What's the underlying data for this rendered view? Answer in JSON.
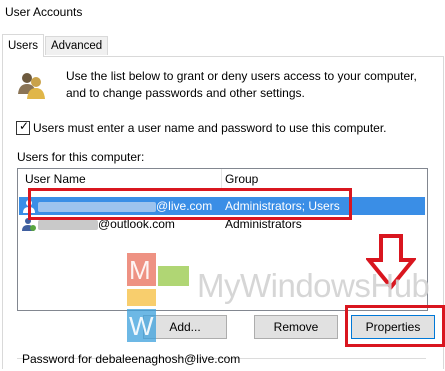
{
  "window": {
    "title": "User Accounts"
  },
  "tabs": [
    {
      "label": "Users",
      "active": true
    },
    {
      "label": "Advanced",
      "active": false
    }
  ],
  "intro_text": "Use the list below to grant or deny users access to your computer, and to change passwords and other settings.",
  "require_login": {
    "checked": true,
    "label": "Users must enter a user name and password to use this computer."
  },
  "users_section_label": "Users for this computer:",
  "users_table": {
    "columns": [
      "User Name",
      "Group"
    ],
    "rows": [
      {
        "name_suffix": "@live.com",
        "group": "Administrators; Users",
        "selected": true
      },
      {
        "name_suffix": "@outlook.com",
        "group": "Administrators",
        "selected": false
      }
    ]
  },
  "buttons": {
    "add": "Add...",
    "remove": "Remove",
    "properties": "Properties"
  },
  "password_section_label": "Password for debaleenaghosh@live.com",
  "watermark": {
    "text": "MyWindowsHub",
    "tile_letters": [
      "M",
      "W"
    ]
  },
  "colors": {
    "selection": "#3a8ee6",
    "annotation_red": "#d9161f"
  }
}
